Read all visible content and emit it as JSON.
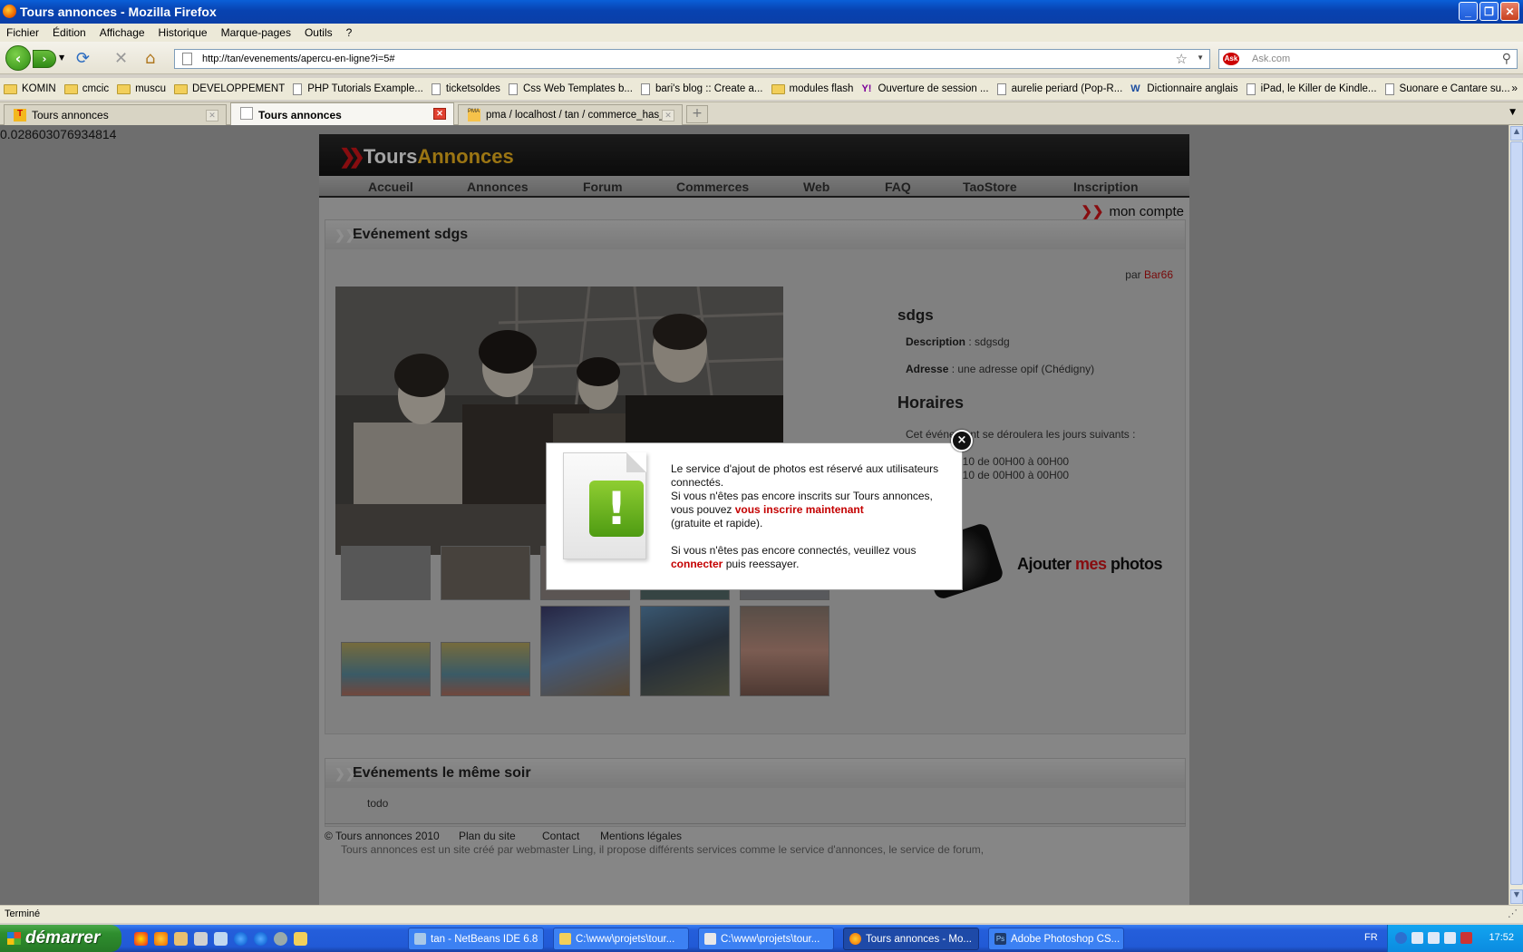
{
  "window": {
    "title": "Tours annonces - Mozilla Firefox",
    "controls": [
      "minimize",
      "maximize",
      "close"
    ]
  },
  "menu": [
    "Fichier",
    "Édition",
    "Affichage",
    "Historique",
    "Marque-pages",
    "Outils",
    "?"
  ],
  "navbar": {
    "url": "http://tan/evenements/apercu-en-ligne?i=5#",
    "search_placeholder": "Ask.com"
  },
  "bookmarks": [
    {
      "icon": "folder",
      "label": "KOMIN"
    },
    {
      "icon": "folder",
      "label": "cmcic"
    },
    {
      "icon": "folder",
      "label": "muscu"
    },
    {
      "icon": "folder",
      "label": "DEVELOPPEMENT"
    },
    {
      "icon": "page",
      "label": "PHP Tutorials Example..."
    },
    {
      "icon": "page",
      "label": "ticketsoldes"
    },
    {
      "icon": "page",
      "label": "Css Web Templates b..."
    },
    {
      "icon": "page",
      "label": "bari's blog :: Create a..."
    },
    {
      "icon": "folder",
      "label": "modules flash"
    },
    {
      "icon": "yahoo",
      "label": "Ouverture de session ..."
    },
    {
      "icon": "page",
      "label": "aurelie periard (Pop-R..."
    },
    {
      "icon": "wr",
      "label": "Dictionnaire anglais"
    },
    {
      "icon": "page",
      "label": "iPad, le Killer de Kindle..."
    },
    {
      "icon": "page",
      "label": "Suonare e Cantare su..."
    }
  ],
  "tabs": [
    {
      "label": "Tours annonces",
      "active": false
    },
    {
      "label": "Tours annonces",
      "active": true
    },
    {
      "label": "pma / localhost / tan / commerce_has_...",
      "active": false
    }
  ],
  "debug_value": "0.028603076934814",
  "site": {
    "logo_part1": "Tours",
    "logo_part2": "Annonces",
    "nav": [
      "Accueil",
      "Annonces",
      "Forum",
      "Commerces",
      "Web",
      "FAQ",
      "TaoStore",
      "Inscription"
    ],
    "account": "mon compte",
    "event_panel_title": "Evénement sdgs",
    "by_label": "par",
    "author": "Bar66",
    "event_name": "sdgs",
    "description_label": "Description",
    "description_value": ": sdgsdg",
    "address_label": "Adresse",
    "address_value": ": une adresse opif (Chédigny)",
    "schedule_title": "Horaires",
    "schedule_intro": "Cet événement se déroulera les jours suivants :",
    "schedule_lines": [
      "010 de 00H00 à 00H00",
      "010 de 00H00 à 00H00"
    ],
    "add_photos": {
      "part1": "Ajouter ",
      "part2": "mes",
      "part3": " photos"
    },
    "same_evening_title": "Evénements le même soir",
    "same_evening_body": "todo",
    "footer_links": [
      "© Tours annonces 2010",
      "Plan du site",
      "Contact",
      "Mentions légales"
    ],
    "footnote": "Tours annonces est un site créé par webmaster Ling, il propose différents services comme le service d'annonces, le service de forum,"
  },
  "modal": {
    "line1": "Le service d'ajout de photos est réservé aux utilisateurs connectés.",
    "line2a": "Si vous n'êtes pas encore inscrits sur Tours annonces, vous pouvez ",
    "line2_link": "vous inscrire maintenant",
    "line2b": "(gratuite et rapide).",
    "line3a": "Si vous n'êtes pas encore connectés, veuillez vous ",
    "line3_link": "connecter",
    "line3b": " puis reessayer.",
    "close_symbol": "×"
  },
  "status": "Terminé",
  "taskbar": {
    "start": "démarrer",
    "tasks": [
      {
        "label": "tan - NetBeans IDE 6.8",
        "active": false
      },
      {
        "label": "C:\\www\\projets\\tour...",
        "active": false
      },
      {
        "label": "C:\\www\\projets\\tour...",
        "active": false
      },
      {
        "label": "Tours annonces - Mo...",
        "active": true
      },
      {
        "label": "Adobe Photoshop CS...",
        "active": false
      }
    ],
    "lang": "FR",
    "clock": "17:52"
  },
  "colors": {
    "brand_red": "#d4151a",
    "brand_yellow": "#f3b81f",
    "xp_blue": "#245edb"
  }
}
